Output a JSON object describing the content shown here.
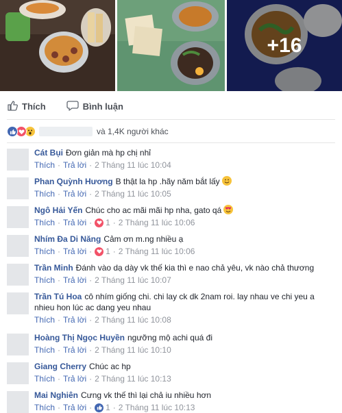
{
  "photos": {
    "more_count": "+16"
  },
  "actions": {
    "like_label": "Thích",
    "comment_label": "Bình luận"
  },
  "reactions": {
    "others_text": "và 1,4K người khác"
  },
  "comments": [
    {
      "name": "Cát Bụi",
      "text": "Đơn giản mà hp chị nhỉ",
      "like": "Thích",
      "reply": "Trả lời",
      "time": "2 Tháng 11 lúc 10:04",
      "emoji": "",
      "reaction": "",
      "count": ""
    },
    {
      "name": "Phan Quỳnh Hương",
      "text": "B thật la hp .hãy năm bắt lấy",
      "like": "Thích",
      "reply": "Trả lời",
      "time": "2 Tháng 11 lúc 10:05",
      "emoji": "smile",
      "reaction": "",
      "count": ""
    },
    {
      "name": "Ngô Hải Yến",
      "text": "Chúc cho ac mãi mãi hp nha, gato qá",
      "like": "Thích",
      "reply": "Trả lời",
      "time": "2 Tháng 11 lúc 10:06",
      "emoji": "heart-eyes",
      "reaction": "love",
      "count": "1"
    },
    {
      "name": "Nhím Đa Di Năng",
      "text": "Cảm ơn m.ng nhiều ạ",
      "like": "Thích",
      "reply": "Trả lời",
      "time": "2 Tháng 11 lúc 10:06",
      "emoji": "",
      "reaction": "love",
      "count": "1"
    },
    {
      "name": "Trần Minh",
      "text": "Đánh vào dạ dày vk thế kia thì e nao chả yêu, vk nào chả thương",
      "like": "Thích",
      "reply": "Trả lời",
      "time": "2 Tháng 11 lúc 10:07",
      "emoji": "",
      "reaction": "",
      "count": ""
    },
    {
      "name": "Trần Tú Hoa",
      "text": "cô nhím giống chi. chi lay ck dk 2nam roi. lay nhau ve chi yeu a nhieu hon lúc ac dang yeu nhau",
      "like": "Thích",
      "reply": "Trả lời",
      "time": "2 Tháng 11 lúc 10:08",
      "emoji": "",
      "reaction": "",
      "count": ""
    },
    {
      "name": "Hoàng Thị Ngọc Huyền",
      "text": "ngưỡng mộ achi quá đi",
      "like": "Thích",
      "reply": "Trả lời",
      "time": "2 Tháng 11 lúc 10:10",
      "emoji": "",
      "reaction": "",
      "count": ""
    },
    {
      "name": "Giang Cherry",
      "text": "Chúc ac hp",
      "like": "Thích",
      "reply": "Trả lời",
      "time": "2 Tháng 11 lúc 10:13",
      "emoji": "",
      "reaction": "",
      "count": ""
    },
    {
      "name": "Mai Nghiên",
      "text": "Cưng vk thế thì lại chả iu nhiều hơn",
      "like": "Thích",
      "reply": "Trả lời",
      "time": "2 Tháng 11 lúc 10:13",
      "emoji": "",
      "reaction": "like",
      "count": "1"
    }
  ]
}
